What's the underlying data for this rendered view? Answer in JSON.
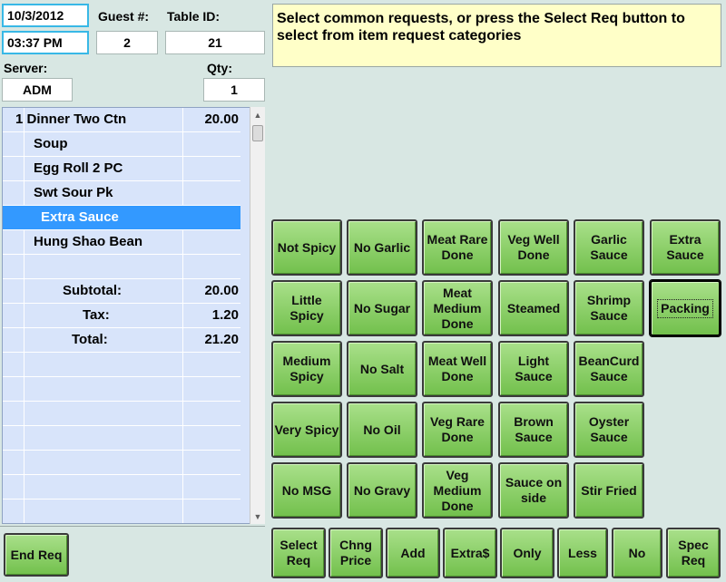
{
  "header": {
    "date": "10/3/2012",
    "time": "03:37 PM",
    "guest_label": "Guest #:",
    "guest_value": "2",
    "table_label": "Table ID:",
    "table_value": "21",
    "server_label": "Server:",
    "server_value": "ADM",
    "qty_label": "Qty:",
    "qty_value": "1"
  },
  "message": "Select common requests, or press the Select Req button to select from item request categories",
  "order": {
    "items": [
      {
        "text": "1 Dinner Two Ctn",
        "amount": "20.00"
      },
      {
        "text": "Soup",
        "amount": ""
      },
      {
        "text": "Egg Roll 2 PC",
        "amount": ""
      },
      {
        "text": "Swt Sour Pk",
        "amount": ""
      },
      {
        "text": "Extra Sauce",
        "amount": ""
      },
      {
        "text": "Hung Shao Bean",
        "amount": ""
      }
    ],
    "subtotal_label": "Subtotal:",
    "subtotal_value": "20.00",
    "tax_label": "Tax:",
    "tax_value": "1.20",
    "total_label": "Total:",
    "total_value": "21.20"
  },
  "requests": [
    [
      "Not Spicy",
      "No Garlic",
      "Meat Rare Done",
      "Veg Well Done",
      "Garlic Sauce",
      "Extra Sauce"
    ],
    [
      "Little Spicy",
      "No Sugar",
      "Meat Medium Done",
      "Steamed",
      "Shrimp Sauce",
      "Packing"
    ],
    [
      "Medium Spicy",
      "No Salt",
      "Meat Well Done",
      "Light Sauce",
      "BeanCurd Sauce"
    ],
    [
      "Very Spicy",
      "No Oil",
      "Veg Rare Done",
      "Brown Sauce",
      "Oyster Sauce"
    ],
    [
      "No MSG",
      "No Gravy",
      "Veg Medium Done",
      "Sauce on side",
      "Stir Fried"
    ]
  ],
  "bottom_buttons": [
    "Select Req",
    "Chng Price",
    "Add",
    "Extra$",
    "Only",
    "Less",
    "No",
    "Spec Req"
  ],
  "end_req": "End Req",
  "colors": {
    "background": "#d8e7e3",
    "button_green": "#8ed36b",
    "list_bg": "#d8e4fa",
    "highlight": "#3399ff",
    "message_bg": "#ffffc8"
  }
}
